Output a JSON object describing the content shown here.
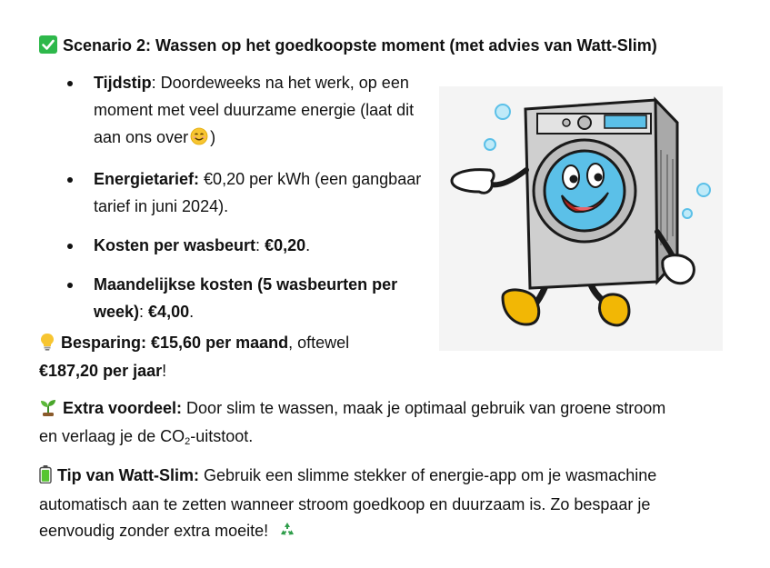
{
  "heading": {
    "icon": "check-mark-icon",
    "text": "Scenario 2: Wassen op het goedkoopste moment (met advies van Watt-Slim)"
  },
  "bullets": [
    {
      "label": "Tijdstip",
      "text": ": Doordeweeks na het werk, op een moment met veel duurzame energie (laat dit aan ons over",
      "emoji": "smile-icon",
      "after": ")"
    },
    {
      "label": "Energietarief:",
      "text": " €0,20 per kWh (een gangbaar tarief in juni 2024)."
    },
    {
      "label": "Kosten per wasbeurt",
      "colon": ": ",
      "value": "€0,20",
      "end": "."
    },
    {
      "label": "Maandelijkse kosten (5 wasbeurten per week)",
      "colon": ": ",
      "value": "€4,00",
      "end": "."
    }
  ],
  "besparing": {
    "icon": "lightbulb-icon",
    "bold1": "Besparing: €15,60 per maand",
    "text": ", oftewel",
    "bold2": "€187,20 per jaar",
    "end": "!"
  },
  "voordeel": {
    "icon": "seedling-icon",
    "label": "Extra voordeel:",
    "text1": " Door slim te wassen, maak je optimaal gebruik van groene stroom",
    "text2": "en verlaag je de CO",
    "sub": "2",
    "text3": "-uitstoot."
  },
  "tip": {
    "icon": "battery-icon",
    "label": "Tip van Watt-Slim:",
    "text1": " Gebruik een slimme stekker of energie-app om je wasmachine",
    "text2": "automatisch aan te zetten wanneer stroom goedkoop en duurzaam is. Zo bespaar je",
    "text3": "eenvoudig zonder extra moeite!",
    "icon2": "recycle-icon"
  },
  "illustration": {
    "name": "washing-machine-mascot",
    "colors": {
      "body": "#cfcfcf",
      "drum": "#5bc0e8",
      "shoes": "#f2b705",
      "bubbles": "#7fd4f2"
    }
  }
}
